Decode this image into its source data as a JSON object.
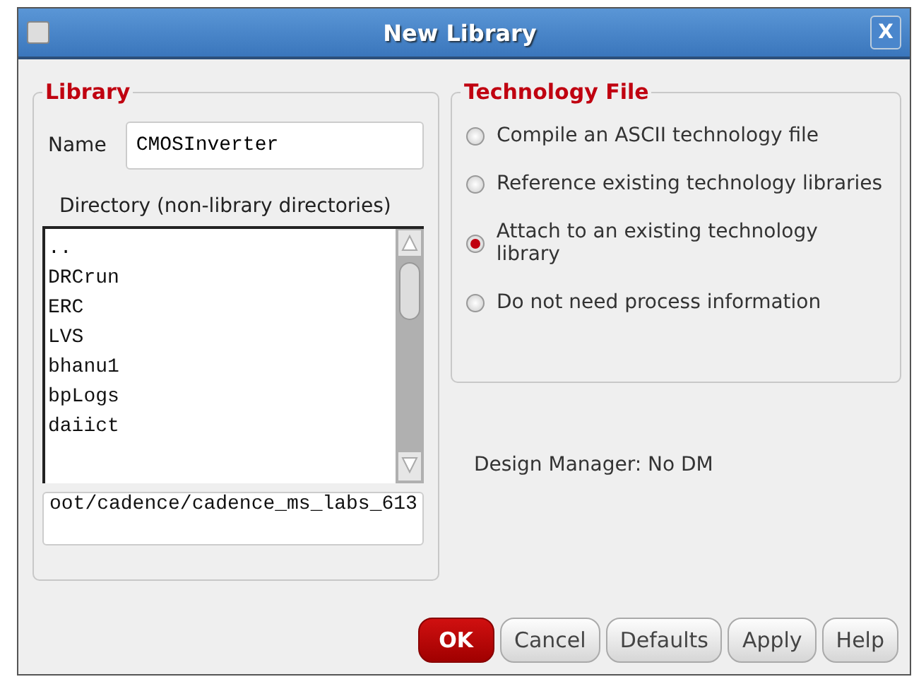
{
  "window": {
    "title": "New Library",
    "close": "X"
  },
  "library": {
    "title": "Library",
    "name_label": "Name",
    "name_value": "CMOSInverter",
    "directory_label": "Directory (non-library directories)",
    "directories": [
      "..",
      "DRCrun",
      "ERC",
      "LVS",
      "bhanu1",
      "bpLogs",
      "daiict"
    ],
    "path_value": "oot/cadence/cadence_ms_labs_613"
  },
  "technology_file": {
    "title": "Technology File",
    "options": [
      {
        "label": "Compile an ASCII technology file",
        "selected": false
      },
      {
        "label": "Reference existing technology libraries",
        "selected": false
      },
      {
        "label": "Attach to an existing technology library",
        "selected": true
      },
      {
        "label": "Do not need process information",
        "selected": false
      }
    ]
  },
  "design_manager": "Design Manager: No DM",
  "buttons": [
    {
      "label": "OK",
      "kind": "primary"
    },
    {
      "label": "Cancel",
      "kind": "normal"
    },
    {
      "label": "Defaults",
      "kind": "normal"
    },
    {
      "label": "Apply",
      "kind": "normal"
    },
    {
      "label": "Help",
      "kind": "normal"
    }
  ]
}
